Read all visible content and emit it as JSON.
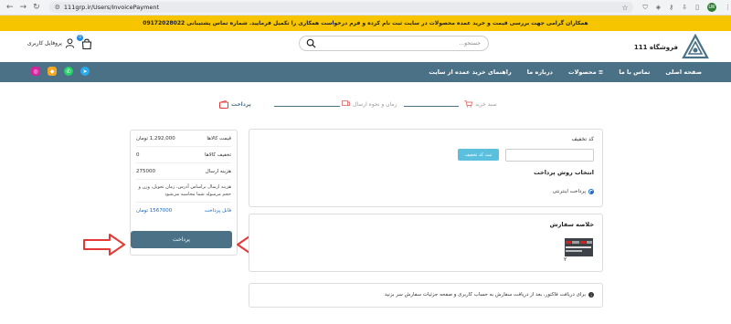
{
  "browser": {
    "url": "111grp.ir/Users/InvoicePayment",
    "back_icon": "←",
    "forward_icon": "→",
    "reload_icon": "↻",
    "avatar_text": "LW"
  },
  "banner": {
    "text": "همکاران گرامی جهت بررسی قیمت و خرید عمده محصولات در سایت ثبت نام کرده و فرم درخواست همکاری را تکمیل فرمایید. شماره تماس پشتیبانی 09172028022"
  },
  "header": {
    "logo_text": "فروشگاه 111",
    "search_placeholder": "جستجو...",
    "profile_label": "پروفایل کاربری",
    "cart_count": "0"
  },
  "nav": {
    "items": [
      "صفحه اصلی",
      "تماس با ما",
      "محصولات",
      "درباره ما",
      "راهنمای خرید عمده از سایت"
    ]
  },
  "steps": {
    "cart": "سبد خرید",
    "shipping": "زمان و نحوه ارسال",
    "payment": "پرداخت"
  },
  "summary": {
    "goods_price_label": "قیمت کالاها",
    "goods_price_value": "1,292,000 تومان",
    "discount_label": "تخفیف کالاها",
    "discount_value": "0",
    "shipping_label": "هزینه ارسال",
    "shipping_value": "275000",
    "note": "هزینه ارسال براساس آدرس، زمان تحویل، وزن و حجم مرسوله شما محاسبه می‌شود",
    "payable_label": "قابل پرداخت",
    "payable_value": "1567000 تومان",
    "pay_button": "پرداخت"
  },
  "discount": {
    "label": "کد تخفیف",
    "apply_button": "ثبت کد تخفیف"
  },
  "payment_method": {
    "title": "انتخاب روش پرداخت",
    "option": "پرداخت اینترنتی"
  },
  "order_summary": {
    "title": "خلاصه سفارش",
    "item_count": "۲"
  },
  "info": {
    "text": "برای دریافت فاکتور، بعد از دریافت سفارش به حساب کاربری و صفحه جزئیات سفارش سر بزنید"
  },
  "colors": {
    "banner": "#f6c500",
    "nav": "#4a7185",
    "arrow": "#e53935",
    "apply_button": "#5bc0de"
  }
}
